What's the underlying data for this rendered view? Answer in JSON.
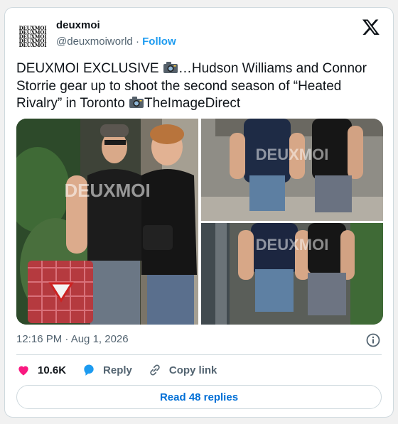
{
  "tweet": {
    "avatar_text": "DEUXMOI",
    "display_name": "deuxmoi",
    "handle": "@deuxmoiworld",
    "separator": "·",
    "follow_label": "Follow",
    "text_part1": "DEUXMOI EXCLUSIVE ",
    "text_part2": "…Hudson Williams and Connor Storrie gear up to shoot the second season of “Heated Rivalry” in Toronto ",
    "text_part3": "TheImageDirect",
    "timestamp": "12:16 PM · Aug 1, 2026",
    "watermark": "DEUXMOI"
  },
  "actions": {
    "likes": "10.6K",
    "reply_label": "Reply",
    "copy_label": "Copy link",
    "read_replies": "Read 48 replies"
  },
  "icons": [
    "x-logo-icon",
    "camera-icon",
    "info-icon",
    "heart-icon",
    "reply-icon",
    "link-icon"
  ],
  "colors": {
    "accent": "#1d9bf0",
    "heart": "#f91880",
    "link": "#006fd6",
    "muted": "#536471"
  }
}
